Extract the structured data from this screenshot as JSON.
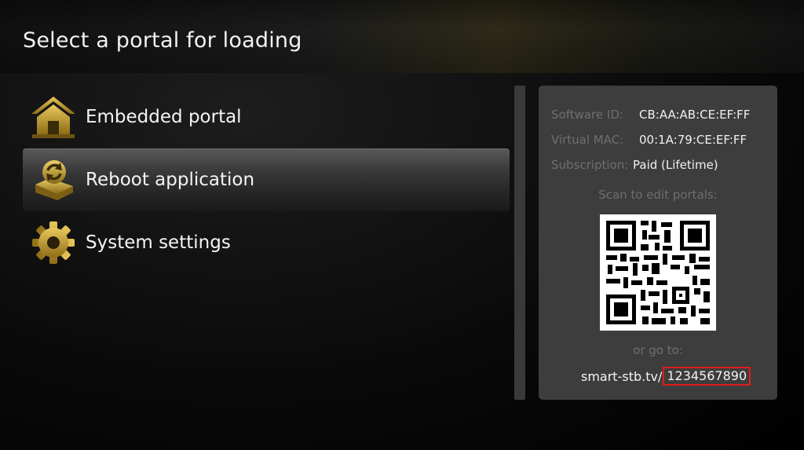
{
  "header": {
    "title": "Select a portal for loading"
  },
  "menu": {
    "items": [
      {
        "label": "Embedded portal",
        "icon": "home-icon",
        "selected": false
      },
      {
        "label": "Reboot application",
        "icon": "reboot-icon",
        "selected": true
      },
      {
        "label": "System settings",
        "icon": "gear-icon",
        "selected": false
      }
    ]
  },
  "info": {
    "software_id_label": "Software ID:",
    "software_id": "CB:AA:AB:CE:EF:FF",
    "virtual_mac_label": "Virtual MAC:",
    "virtual_mac": "00:1A:79:CE:EF:FF",
    "subscription_label": "Subscription:",
    "subscription": "Paid (Lifetime)",
    "scan_label": "Scan to edit portals:",
    "goto_label": "or go to:",
    "url_base": "smart-stb.tv/",
    "url_id": "1234567890"
  },
  "colors": {
    "accent_gold": "#c9a233",
    "highlight_red": "#e01b1b",
    "panel_bg": "#3d3d3d"
  }
}
